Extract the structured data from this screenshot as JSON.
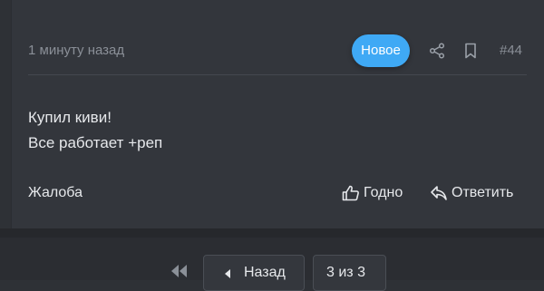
{
  "post": {
    "time": "1 минуту назад",
    "badge": "Новое",
    "number": "#44",
    "lines": [
      "Купил киви!",
      "Все работает +реп"
    ],
    "report_label": "Жалоба",
    "like_label": "Годно",
    "reply_label": "Ответить"
  },
  "pagination": {
    "back_label": "Назад",
    "page_indicator": "3 из 3"
  },
  "icons": {
    "share": "share-icon",
    "bookmark": "bookmark-icon",
    "like": "thumbs-up-icon",
    "reply": "reply-icon",
    "first_page": "double-chevron-left-icon",
    "back": "caret-left-icon"
  },
  "colors": {
    "accent": "#3fa9f5",
    "background": "#33363c",
    "text": "#e6e8eb",
    "muted": "#8a8f97"
  }
}
